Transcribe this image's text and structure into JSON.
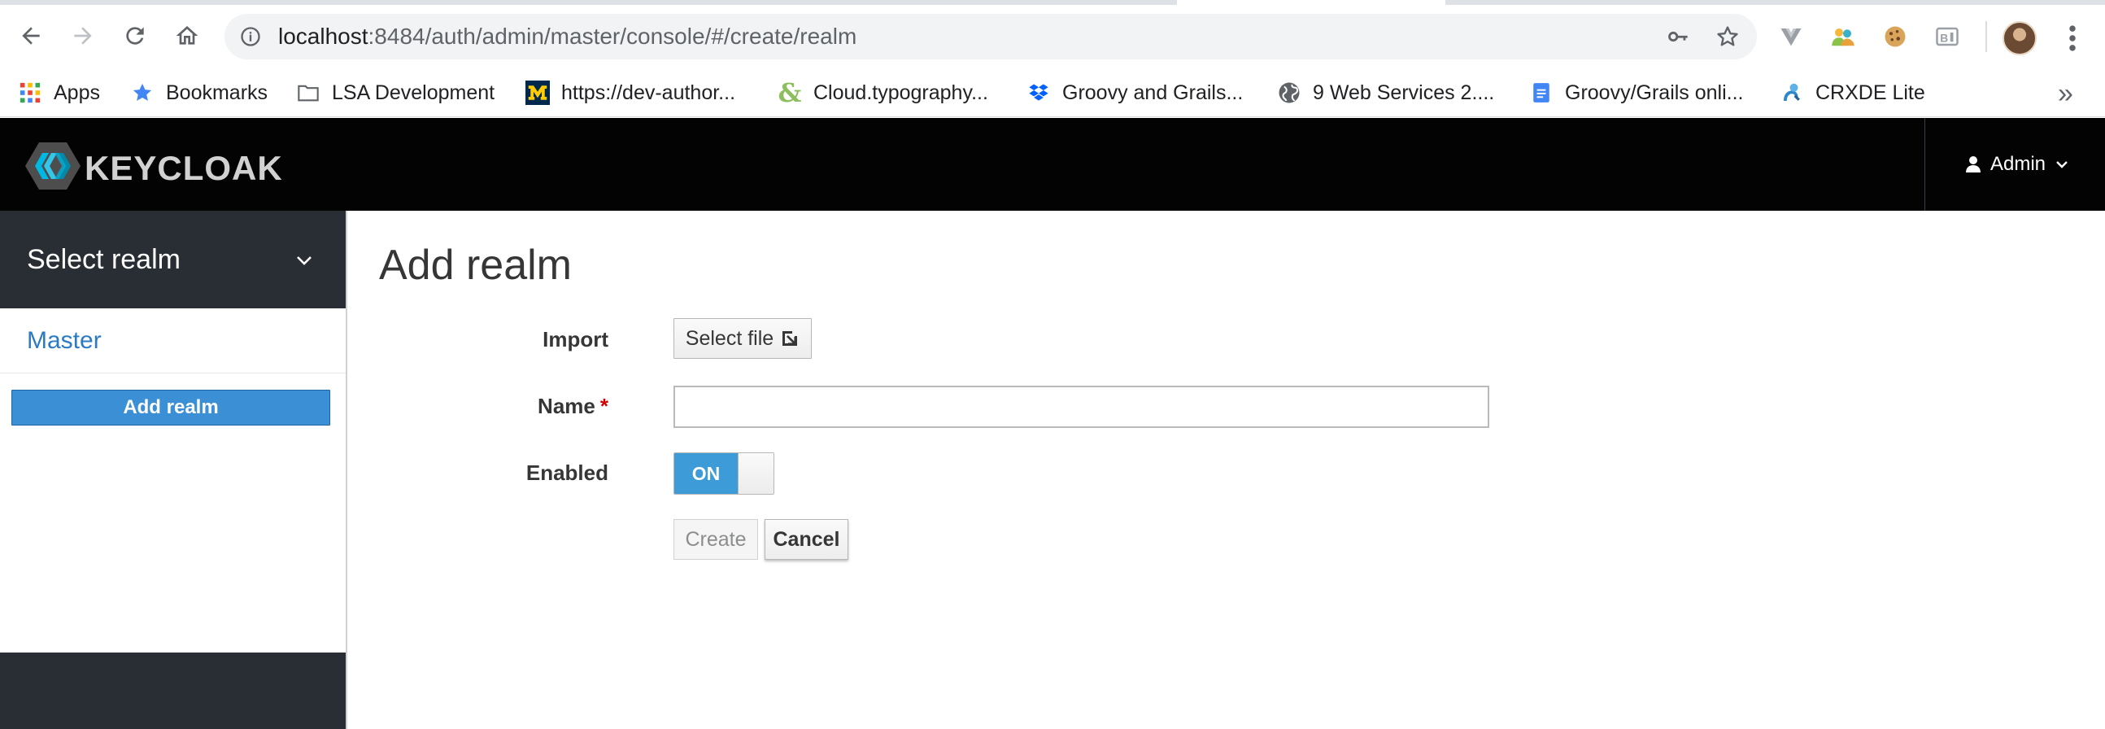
{
  "browser": {
    "url_host": "localhost",
    "url_path": ":8484/auth/admin/master/console/#/create/realm",
    "bookmarks": [
      {
        "label": "Apps",
        "icon": "apps-grid-icon"
      },
      {
        "label": "Bookmarks",
        "icon": "star-icon"
      },
      {
        "label": "LSA Development",
        "icon": "folder-icon"
      },
      {
        "label": "https://dev-author...",
        "icon": "michigan-m-icon"
      },
      {
        "label": "Cloud.typography...",
        "icon": "ampersand-icon"
      },
      {
        "label": "Groovy and Grails...",
        "icon": "dropbox-icon"
      },
      {
        "label": "9 Web Services 2....",
        "icon": "globe-icon"
      },
      {
        "label": "Groovy/Grails onli...",
        "icon": "google-docs-icon"
      },
      {
        "label": "CRXDE Lite",
        "icon": "crxde-icon"
      }
    ],
    "more_bookmarks": "»"
  },
  "header": {
    "logo_text": "KEYCLOAK",
    "user_label": "Admin"
  },
  "sidebar": {
    "realm_select_label": "Select realm",
    "realms": [
      "Master"
    ],
    "add_realm_label": "Add realm"
  },
  "main": {
    "title": "Add realm",
    "import_label": "Import",
    "select_file_label": "Select file",
    "name_label": "Name",
    "name_required_mark": "*",
    "name_value": "",
    "enabled_label": "Enabled",
    "enabled_toggle_text": "ON",
    "enabled": true,
    "create_label": "Create",
    "cancel_label": "Cancel"
  },
  "colors": {
    "header_bg": "#030303",
    "sidebar_bg": "#292e34",
    "primary_button": "#3a8fd5",
    "link_blue": "#2a7bc4",
    "required_red": "#cc0000"
  }
}
